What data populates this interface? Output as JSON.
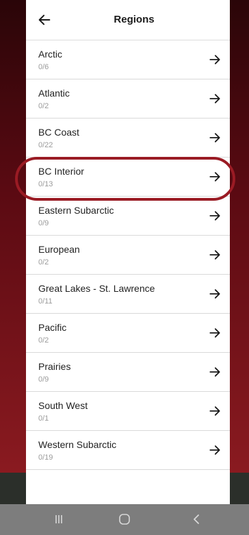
{
  "header": {
    "title": "Regions",
    "back_icon": "arrow-left-icon"
  },
  "regions": [
    {
      "name": "Arctic",
      "count": "0/6"
    },
    {
      "name": "Atlantic",
      "count": "0/2"
    },
    {
      "name": "BC Coast",
      "count": "0/22"
    },
    {
      "name": "BC Interior",
      "count": "0/13",
      "highlighted": true
    },
    {
      "name": "Eastern Subarctic",
      "count": "0/9"
    },
    {
      "name": "European",
      "count": "0/2"
    },
    {
      "name": "Great Lakes - St. Lawrence",
      "count": "0/11"
    },
    {
      "name": "Pacific",
      "count": "0/2"
    },
    {
      "name": "Prairies",
      "count": "0/9"
    },
    {
      "name": "South West",
      "count": "0/1"
    },
    {
      "name": "Western Subarctic",
      "count": "0/19"
    }
  ],
  "row_icon": "arrow-right-icon",
  "highlight_color": "#9a1b24",
  "nav_bar": {
    "recents_icon": "recent-apps-icon",
    "home_icon": "home-icon",
    "back_icon": "back-chevron-icon"
  }
}
